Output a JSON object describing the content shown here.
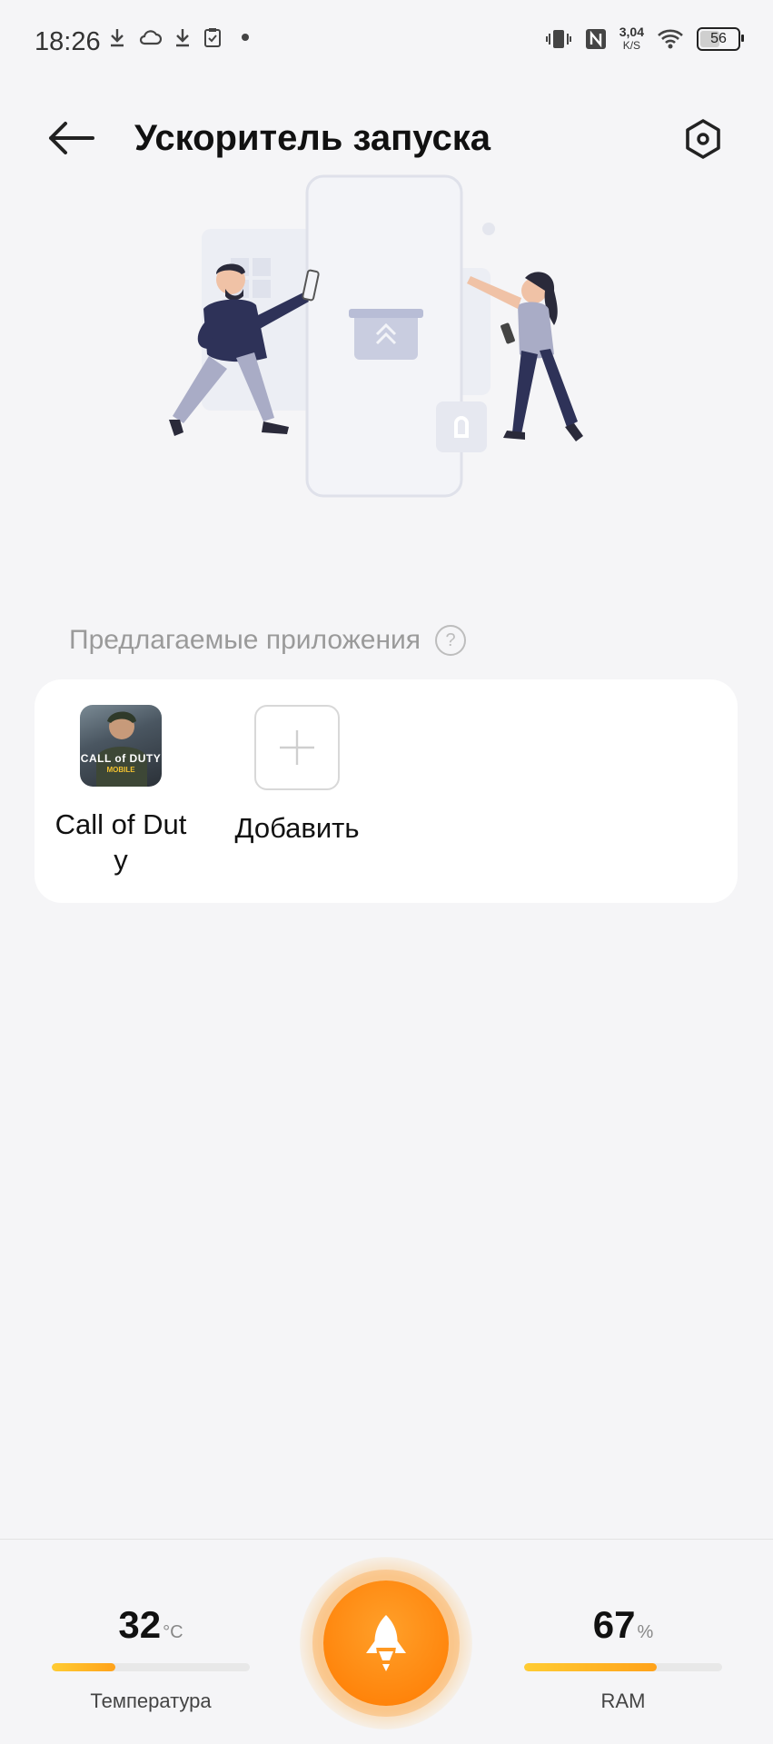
{
  "status_bar": {
    "time": "18:26",
    "speed_value": "3,04",
    "speed_unit": "K/S",
    "battery_level": "56",
    "battery_percent": 56
  },
  "header": {
    "title": "Ускоритель запуска"
  },
  "suggested": {
    "label": "Предлагаемые приложения",
    "help_glyph": "?",
    "apps": [
      {
        "label": "Call of Duty",
        "icon_text": "CALL of DUTY",
        "icon_subtext": "MOBILE"
      },
      {
        "label": "Добавить",
        "icon": "plus-icon"
      }
    ]
  },
  "stats": {
    "temperature": {
      "value": "32",
      "unit": "°C",
      "label": "Температура",
      "level_percent": 32
    },
    "ram": {
      "value": "67",
      "unit": "%",
      "label": "RAM",
      "level_percent": 67
    }
  },
  "colors": {
    "accent": "#ff8a00",
    "background": "#f5f5f7",
    "card": "#ffffff"
  }
}
